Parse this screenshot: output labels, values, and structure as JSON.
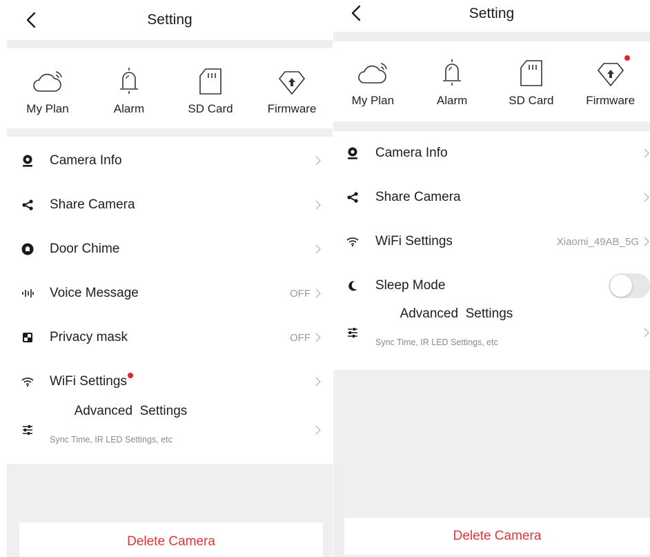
{
  "colors": {
    "accent": "#e0353b",
    "badge": "#e5242a",
    "background": "#efeff1"
  },
  "left": {
    "header": {
      "title": "Setting",
      "back_icon": "chevron-left-icon"
    },
    "tiles": [
      {
        "label": "My Plan",
        "icon": "cloud-icon"
      },
      {
        "label": "Alarm",
        "icon": "bell-icon"
      },
      {
        "label": "SD Card",
        "icon": "sd-card-icon"
      },
      {
        "label": "Firmware",
        "icon": "firmware-icon"
      }
    ],
    "menu": [
      {
        "label": "Camera Info",
        "icon": "camera-icon"
      },
      {
        "label": "Share Camera",
        "icon": "share-icon"
      },
      {
        "label": "Door Chime",
        "icon": "door-chime-icon"
      },
      {
        "label": "Voice Message",
        "icon": "voice-wave-icon",
        "value": "OFF"
      },
      {
        "label": "Privacy mask",
        "icon": "privacy-mask-icon",
        "value": "OFF"
      },
      {
        "label": "WiFi Settings",
        "icon": "wifi-icon"
      },
      {
        "label": "Advanced  Settings",
        "icon": "sliders-icon",
        "sub": "Sync Time, IR LED Settings, etc"
      }
    ],
    "delete_label": "Delete Camera"
  },
  "right": {
    "header": {
      "title": "Setting",
      "back_icon": "chevron-left-icon"
    },
    "tiles": [
      {
        "label": "My Plan",
        "icon": "cloud-icon"
      },
      {
        "label": "Alarm",
        "icon": "bell-icon"
      },
      {
        "label": "SD Card",
        "icon": "sd-card-icon"
      },
      {
        "label": "Firmware",
        "icon": "firmware-icon"
      }
    ],
    "menu": [
      {
        "label": "Camera Info",
        "icon": "camera-icon"
      },
      {
        "label": "Share Camera",
        "icon": "share-icon"
      },
      {
        "label": "WiFi Settings",
        "icon": "wifi-icon",
        "value": "Xiaomi_49AB_5G"
      },
      {
        "label": "Sleep Mode",
        "icon": "moon-icon",
        "toggle": false
      },
      {
        "label": "Advanced  Settings",
        "icon": "sliders-icon",
        "sub": "Sync Time, IR LED Settings, etc"
      }
    ],
    "delete_label": "Delete Camera"
  }
}
